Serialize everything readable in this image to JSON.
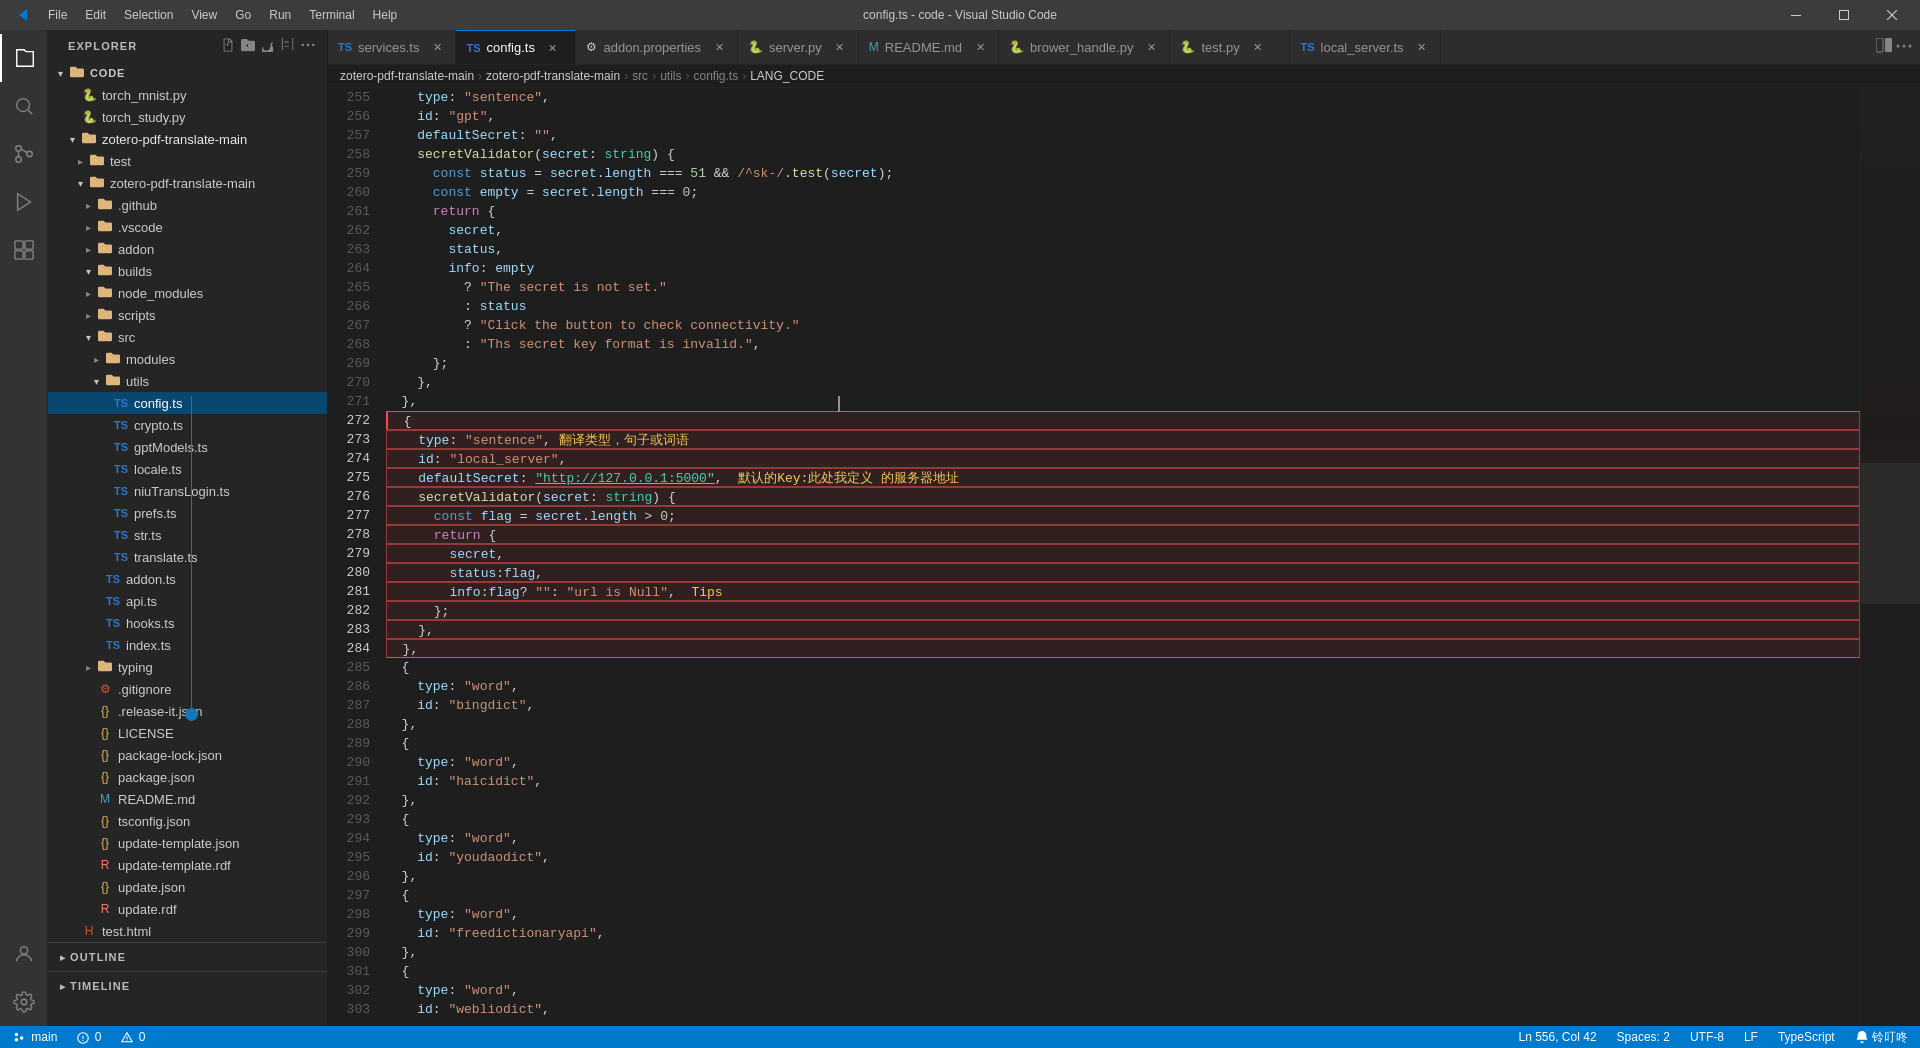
{
  "titlebar": {
    "title": "config.ts - code - Visual Studio Code",
    "menu": [
      "File",
      "Edit",
      "Selection",
      "View",
      "Go",
      "Run",
      "Terminal",
      "Help"
    ]
  },
  "tabs": [
    {
      "id": "services",
      "label": "services.ts",
      "icon": "TS",
      "active": false,
      "closeable": true
    },
    {
      "id": "config",
      "label": "config.ts",
      "icon": "TS",
      "active": true,
      "closeable": true
    },
    {
      "id": "addon-properties",
      "label": "addon.properties",
      "icon": "prop",
      "active": false,
      "closeable": true
    },
    {
      "id": "server",
      "label": "server.py",
      "icon": "py",
      "active": false,
      "closeable": true
    },
    {
      "id": "readme",
      "label": "README.md",
      "icon": "md",
      "active": false,
      "closeable": true
    },
    {
      "id": "brower-handle",
      "label": "brower_handle.py",
      "icon": "py",
      "active": false,
      "closeable": true
    },
    {
      "id": "test",
      "label": "test.py",
      "icon": "py",
      "active": false,
      "closeable": true
    },
    {
      "id": "local-server",
      "label": "local_server.ts",
      "icon": "TS",
      "active": false,
      "closeable": true
    }
  ],
  "breadcrumb": {
    "items": [
      "zotero-pdf-translate-main",
      "zotero-pdf-translate-main",
      "src",
      "utils",
      "config.ts",
      "LANG_CODE"
    ]
  },
  "sidebar": {
    "title": "EXPLORER",
    "root": "CODE",
    "files": [
      {
        "level": 1,
        "type": "file",
        "icon": "py",
        "name": "torch_mnist.py"
      },
      {
        "level": 1,
        "type": "file",
        "icon": "py",
        "name": "torch_study.py"
      },
      {
        "level": 1,
        "type": "folder-open",
        "icon": "folder",
        "name": "zotero-pdf-translate-main",
        "expanded": true
      },
      {
        "level": 2,
        "type": "folder-closed",
        "icon": "folder",
        "name": "test"
      },
      {
        "level": 2,
        "type": "folder-open",
        "icon": "folder",
        "name": "zotero-pdf-translate-main",
        "expanded": true
      },
      {
        "level": 3,
        "type": "folder-closed",
        "icon": "folder",
        "name": ".github"
      },
      {
        "level": 3,
        "type": "folder-closed",
        "icon": "folder",
        "name": ".vscode"
      },
      {
        "level": 3,
        "type": "folder-closed",
        "icon": "folder",
        "name": "addon"
      },
      {
        "level": 3,
        "type": "folder-open",
        "icon": "folder",
        "name": "builds",
        "expanded": true
      },
      {
        "level": 3,
        "type": "folder-closed",
        "icon": "folder",
        "name": "node_modules"
      },
      {
        "level": 3,
        "type": "folder-closed",
        "icon": "folder",
        "name": "scripts"
      },
      {
        "level": 3,
        "type": "folder-open",
        "icon": "folder",
        "name": "src",
        "expanded": true
      },
      {
        "level": 4,
        "type": "folder-closed",
        "icon": "folder",
        "name": "modules"
      },
      {
        "level": 4,
        "type": "folder-open",
        "icon": "folder",
        "name": "utils",
        "expanded": true
      },
      {
        "level": 5,
        "type": "file",
        "icon": "ts",
        "name": "config.ts",
        "active": true
      },
      {
        "level": 5,
        "type": "file",
        "icon": "ts",
        "name": "crypto.ts"
      },
      {
        "level": 5,
        "type": "file",
        "icon": "ts",
        "name": "gptModels.ts"
      },
      {
        "level": 5,
        "type": "file",
        "icon": "ts",
        "name": "locale.ts"
      },
      {
        "level": 5,
        "type": "file",
        "icon": "ts",
        "name": "niuTransLogin.ts"
      },
      {
        "level": 5,
        "type": "file",
        "icon": "ts",
        "name": "prefs.ts"
      },
      {
        "level": 5,
        "type": "file",
        "icon": "ts",
        "name": "str.ts"
      },
      {
        "level": 5,
        "type": "file",
        "icon": "ts",
        "name": "translate.ts"
      },
      {
        "level": 4,
        "type": "file",
        "icon": "ts",
        "name": "addon.ts"
      },
      {
        "level": 4,
        "type": "file",
        "icon": "ts",
        "name": "api.ts"
      },
      {
        "level": 4,
        "type": "file",
        "icon": "ts",
        "name": "hooks.ts"
      },
      {
        "level": 4,
        "type": "file",
        "icon": "ts",
        "name": "index.ts"
      },
      {
        "level": 3,
        "type": "folder-closed",
        "icon": "folder",
        "name": "typing"
      },
      {
        "level": 3,
        "type": "file",
        "icon": "git",
        "name": ".gitignore"
      },
      {
        "level": 3,
        "type": "file",
        "icon": "json",
        "name": ".release-it.json"
      },
      {
        "level": 3,
        "type": "file",
        "icon": "txt",
        "name": "LICENSE"
      },
      {
        "level": 3,
        "type": "file",
        "icon": "json",
        "name": "package-lock.json"
      },
      {
        "level": 3,
        "type": "file",
        "icon": "json",
        "name": "package.json"
      },
      {
        "level": 3,
        "type": "file",
        "icon": "md",
        "name": "README.md"
      },
      {
        "level": 3,
        "type": "file",
        "icon": "json",
        "name": "tsconfig.json"
      },
      {
        "level": 3,
        "type": "file",
        "icon": "json",
        "name": "update-template.json"
      },
      {
        "level": 3,
        "type": "file",
        "icon": "rdf",
        "name": "update-template.rdf"
      },
      {
        "level": 3,
        "type": "file",
        "icon": "json",
        "name": "update.json"
      },
      {
        "level": 3,
        "type": "file",
        "icon": "rdf",
        "name": "update.rdf"
      },
      {
        "level": 1,
        "type": "file",
        "icon": "html",
        "name": "test.html"
      }
    ],
    "outline": "OUTLINE",
    "timeline": "TIMELINE"
  },
  "status": {
    "branch": "main",
    "errors": "0",
    "warnings": "0",
    "line": "Ln 556, Col 42",
    "spaces": "Spaces: 2",
    "encoding": "UTF-8",
    "eol": "LF",
    "language": "TypeScript",
    "notify": "铃叮咚"
  },
  "code": {
    "lines": [
      {
        "num": 255,
        "text": "    type: \"sentence\","
      },
      {
        "num": 256,
        "text": "    id: \"gpt\","
      },
      {
        "num": 257,
        "text": "    defaultSecret: \"\","
      },
      {
        "num": 258,
        "text": "    secretValidator(secret: string) {"
      },
      {
        "num": 259,
        "text": "      const status = secret.length === 51 && /^sk-/.test(secret);"
      },
      {
        "num": 260,
        "text": "      const empty = secret.length === 0;"
      },
      {
        "num": 261,
        "text": "      return {"
      },
      {
        "num": 262,
        "text": "        secret,"
      },
      {
        "num": 263,
        "text": "        status,"
      },
      {
        "num": 264,
        "text": "        info: empty"
      },
      {
        "num": 265,
        "text": "          ? \"The secret is not set.\""
      },
      {
        "num": 266,
        "text": "          : status"
      },
      {
        "num": 267,
        "text": "          ? \"Click the button to check connectivity.\""
      },
      {
        "num": 268,
        "text": "          : \"Ths secret key format is invalid.\","
      },
      {
        "num": 269,
        "text": "      };"
      },
      {
        "num": 270,
        "text": "    },"
      },
      {
        "num": 271,
        "text": "  },"
      },
      {
        "num": 272,
        "text": "  {"
      },
      {
        "num": 273,
        "text": "    type: \"sentence\", 翻译类型，句子或词语"
      },
      {
        "num": 274,
        "text": "    id: \"local_server\","
      },
      {
        "num": 275,
        "text": "    defaultSecret: \"http://127.0.0.1:5000\",  默认的Key:此处我定义 的服务器地址"
      },
      {
        "num": 276,
        "text": "    secretValidator(secret: string) {"
      },
      {
        "num": 277,
        "text": "      const flag = secret.length > 0;"
      },
      {
        "num": 278,
        "text": "      return {"
      },
      {
        "num": 279,
        "text": "        secret,"
      },
      {
        "num": 280,
        "text": "        status:flag,"
      },
      {
        "num": 281,
        "text": "        info:flag? \"\": \"url is Null\",  Tips"
      },
      {
        "num": 282,
        "text": "      };"
      },
      {
        "num": 283,
        "text": "    },"
      },
      {
        "num": 284,
        "text": "  },"
      },
      {
        "num": 285,
        "text": "  {"
      },
      {
        "num": 286,
        "text": "    type: \"word\","
      },
      {
        "num": 287,
        "text": "    id: \"bingdict\","
      },
      {
        "num": 288,
        "text": "  },"
      },
      {
        "num": 289,
        "text": "  {"
      },
      {
        "num": 290,
        "text": "    type: \"word\","
      },
      {
        "num": 291,
        "text": "    id: \"haicidict\","
      },
      {
        "num": 292,
        "text": "  },"
      },
      {
        "num": 293,
        "text": "  {"
      },
      {
        "num": 294,
        "text": "    type: \"word\","
      },
      {
        "num": 295,
        "text": "    id: \"youdaodict\","
      },
      {
        "num": 296,
        "text": "  },"
      },
      {
        "num": 297,
        "text": "  {"
      },
      {
        "num": 298,
        "text": "    type: \"word\","
      },
      {
        "num": 299,
        "text": "    id: \"freedictionaryapi\","
      },
      {
        "num": 300,
        "text": "  },"
      },
      {
        "num": 301,
        "text": "  {"
      },
      {
        "num": 302,
        "text": "    type: \"word\","
      },
      {
        "num": 303,
        "text": "    id: \"webliodict\","
      }
    ],
    "tooltip": {
      "lines": [
        "    type: \"sentence\", 翻译类型，句子或词语",
        "    id: \"local_server\",",
        "    defaultSecret: \"http://127.0.0.1:5000\",  默认的Key:此处我定义 的服务器地址",
        "    secretValidator(secret: string) {",
        "      const flag = secret.length > 0;",
        "      return {",
        "        secret,",
        "        status:flag,",
        "        info:flag? \"\": \"url is Null\",  Tips",
        "      };",
        "    },",
        "  },"
      ]
    }
  }
}
